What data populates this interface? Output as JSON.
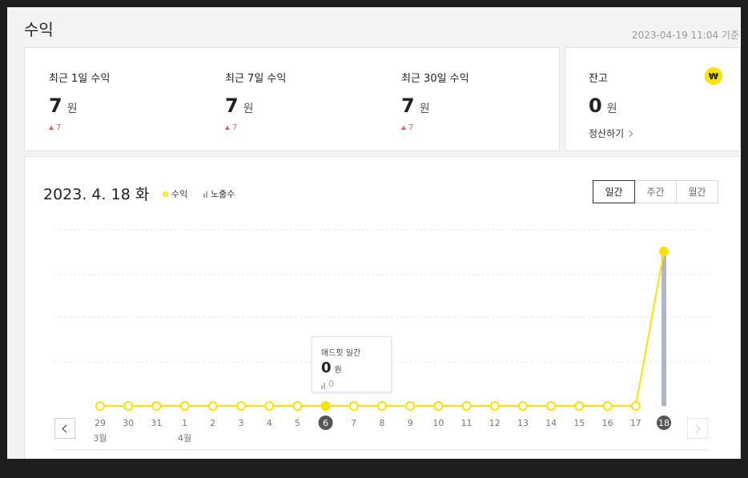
{
  "page": {
    "title": "수익",
    "timestamp": "2023-04-19 11:04 기준"
  },
  "stats": [
    {
      "label": "최근 1일 수익",
      "value": "7",
      "unit": "원",
      "delta": "7"
    },
    {
      "label": "최근 7일 수익",
      "value": "7",
      "unit": "원",
      "delta": "7"
    },
    {
      "label": "최근 30일 수익",
      "value": "7",
      "unit": "원",
      "delta": "7"
    }
  ],
  "balance": {
    "label": "잔고",
    "value": "0",
    "unit": "원",
    "badge": "₩",
    "settle_label": "정산하기"
  },
  "chart_header": {
    "date": "2023. 4. 18 화",
    "legend_revenue": "수익",
    "legend_impressions": "노출수"
  },
  "period_tabs": [
    {
      "label": "일간",
      "active": true
    },
    {
      "label": "주간",
      "active": false
    },
    {
      "label": "월간",
      "active": false
    }
  ],
  "tooltip": {
    "title": "애드핏 일간",
    "value": "0",
    "unit": "원",
    "impressions": "0"
  },
  "colors": {
    "revenue": "#ffe100",
    "impressions": "#aeb7c3",
    "delta_up": "#e8554e",
    "selected_day": "#555555"
  },
  "chart_data": {
    "type": "line",
    "categories": [
      "29",
      "30",
      "31",
      "1",
      "2",
      "3",
      "4",
      "5",
      "6",
      "7",
      "8",
      "9",
      "10",
      "11",
      "12",
      "13",
      "14",
      "15",
      "16",
      "17",
      "18"
    ],
    "month_labels": [
      {
        "index": 0,
        "label": "3월"
      },
      {
        "index": 3,
        "label": "4월"
      }
    ],
    "highlighted_categories": [
      "6",
      "18"
    ],
    "series": [
      {
        "name": "수익",
        "type": "line",
        "values": [
          0,
          0,
          0,
          0,
          0,
          0,
          0,
          0,
          0,
          0,
          0,
          0,
          0,
          0,
          0,
          0,
          0,
          0,
          0,
          0,
          7
        ]
      },
      {
        "name": "노출수",
        "type": "bar",
        "values": [
          0,
          0,
          0,
          0,
          0,
          0,
          0,
          0,
          0,
          0,
          0,
          0,
          0,
          0,
          0,
          0,
          0,
          0,
          0,
          0,
          1
        ]
      }
    ],
    "grid": true
  }
}
